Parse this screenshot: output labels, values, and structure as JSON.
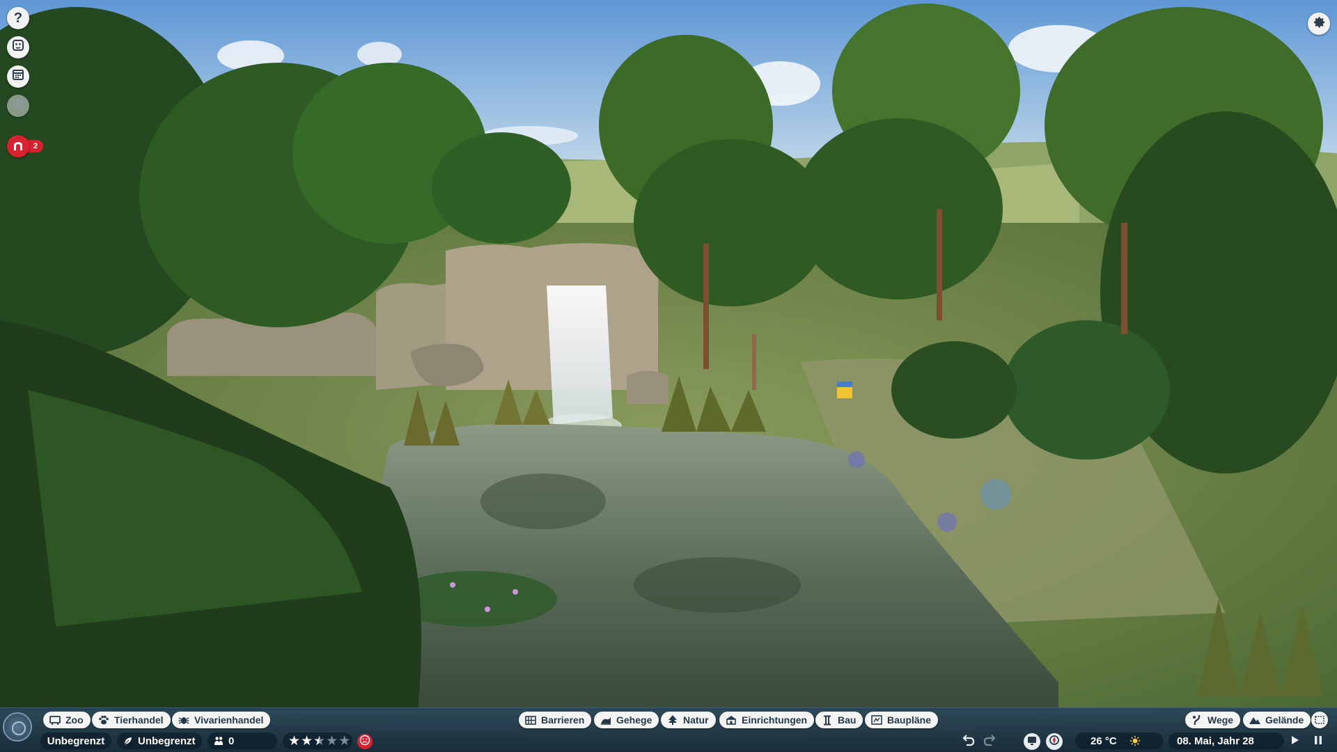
{
  "left_toolbar": {
    "help_icon": "question-mark-icon",
    "items": [
      {
        "name": "help-button",
        "icon": "question-mark-icon",
        "label": "?"
      },
      {
        "name": "animals-overview-button",
        "icon": "animal-face-icon"
      },
      {
        "name": "calendar-button",
        "icon": "calendar-icon"
      },
      {
        "name": "camera-button",
        "icon": "camera-icon"
      }
    ],
    "alert": {
      "icon": "guest-alert-icon",
      "count": "2"
    }
  },
  "settings_icon": "gear-icon",
  "bottom_bar": {
    "left_menu": [
      {
        "key": "zoo",
        "label": "Zoo",
        "icon": "zoo-icon"
      },
      {
        "key": "trade",
        "label": "Tierhandel",
        "icon": "paw-icon"
      },
      {
        "key": "vivarium",
        "label": "Vivarienhandel",
        "icon": "bug-icon"
      }
    ],
    "center_menu": [
      {
        "key": "barriers",
        "label": "Barrieren",
        "icon": "fence-icon"
      },
      {
        "key": "habitats",
        "label": "Gehege",
        "icon": "habitat-icon"
      },
      {
        "key": "nature",
        "label": "Natur",
        "icon": "tree-icon"
      },
      {
        "key": "facilities",
        "label": "Einrichtungen",
        "icon": "building-icon"
      },
      {
        "key": "construction",
        "label": "Bau",
        "icon": "pillar-icon"
      },
      {
        "key": "blueprints",
        "label": "Baupläne",
        "icon": "blueprint-icon"
      }
    ],
    "right_menu": [
      {
        "key": "paths",
        "label": "Wege",
        "icon": "path-icon"
      },
      {
        "key": "terrain",
        "label": "Gelände",
        "icon": "mountain-icon"
      }
    ],
    "stats": {
      "money": "Unbegrenzt",
      "research": "Unbegrenzt",
      "guests": "0",
      "rating_stars": 2.5,
      "rating_max": 5
    },
    "weather": {
      "temperature": "26 °C",
      "icon": "sun-icon"
    },
    "date": "08. Mai, Jahr 28",
    "colors": {
      "alert_red": "#d8222f",
      "pill_bg": "#f4f4f2",
      "pill_text": "#24384a",
      "hud_bg": "#22405a"
    }
  }
}
